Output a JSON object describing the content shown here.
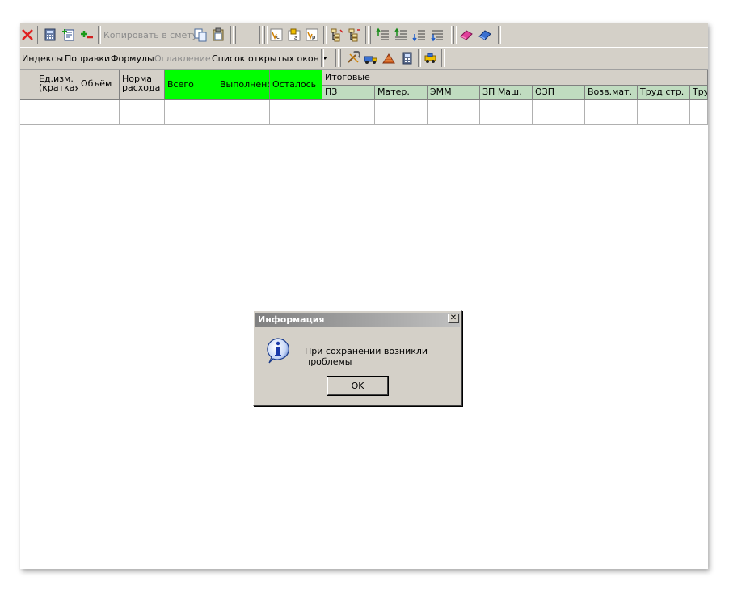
{
  "toolbar_row1": {
    "copy_to_estimate_label": "Копировать в смету"
  },
  "toolbar_row2": {
    "indexes_label": "Индексы",
    "corrections_label": "Поправки",
    "formulas_label": "Формулы",
    "contents_label": "Оглавление",
    "open_windows_label": "Список открытых окон"
  },
  "grid": {
    "headers": {
      "unit": "Ед.изм. (краткая)",
      "volume": "Объём",
      "norm": "Норма расхода",
      "total": "Всего",
      "done": "Выполнено",
      "remaining": "Осталось",
      "totals_group": "Итоговые"
    },
    "sub_headers": [
      "ПЗ",
      "Матер.",
      "ЭММ",
      "ЗП Маш.",
      "ОЗП",
      "Возв.мат.",
      "Труд стр.",
      "Труд"
    ]
  },
  "dialog": {
    "title": "Информация",
    "close_glyph": "✕",
    "message": "При сохранении возникли проблемы",
    "ok_label": "OK"
  },
  "colors": {
    "green_header": "#00ff00",
    "lightgreen_header": "#c0dcc0",
    "toolbar_bg": "#d4d0c8"
  }
}
